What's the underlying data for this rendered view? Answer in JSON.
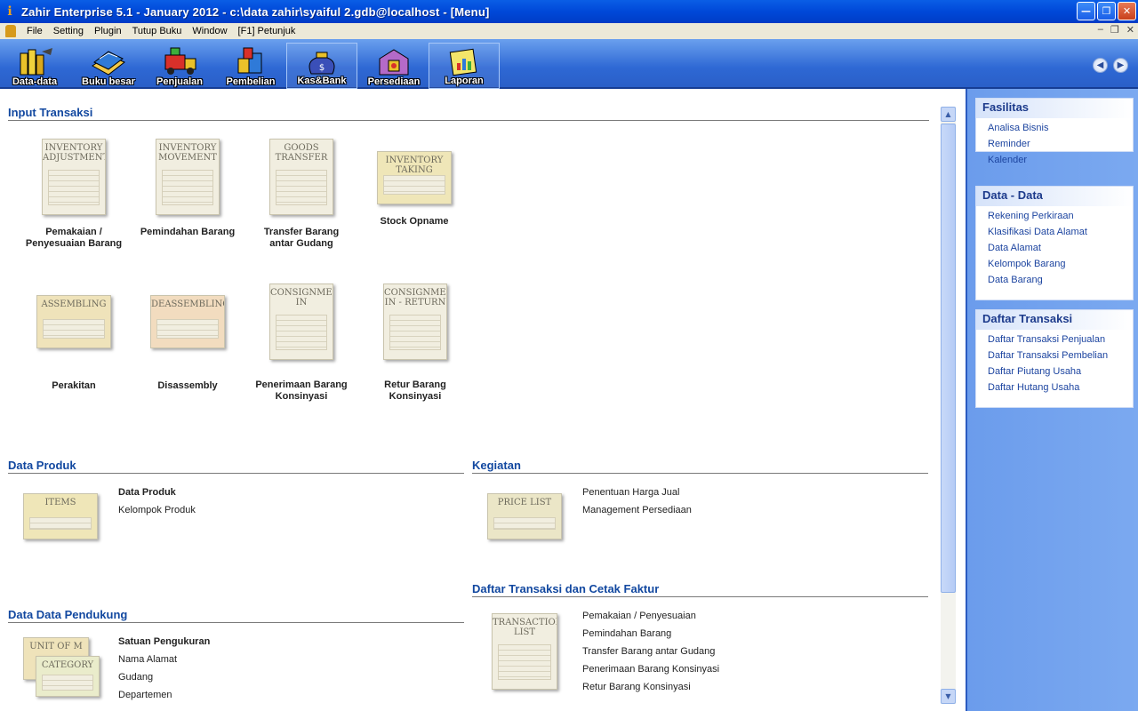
{
  "window": {
    "title": "Zahir Enterprise 5.1 - January 2012 - c:\\data zahir\\syaiful 2.gdb@localhost - [Menu]"
  },
  "menu": [
    "File",
    "Setting",
    "Plugin",
    "Tutup Buku",
    "Window",
    "[F1] Petunjuk"
  ],
  "toolbar": [
    {
      "label": "Data-data",
      "icon": "data-data-icon"
    },
    {
      "label": "Buku besar",
      "icon": "ledger-books-icon"
    },
    {
      "label": "Penjualan",
      "icon": "sales-truck-icon"
    },
    {
      "label": "Pembelian",
      "icon": "purchase-boxes-icon"
    },
    {
      "label": "Kas&Bank",
      "icon": "money-bag-icon",
      "selected": true
    },
    {
      "label": "Persediaan",
      "icon": "warehouse-icon"
    },
    {
      "label": "Laporan",
      "icon": "report-chart-icon",
      "selected": true
    }
  ],
  "sections": {
    "input_transaksi": "Input Transaksi",
    "data_produk": "Data Produk",
    "kegiatan": "Kegiatan",
    "daftar_transaksi": "Daftar Transaksi dan Cetak Faktur",
    "data_pendukung": "Data Data Pendukung"
  },
  "tiles": {
    "t1": {
      "doc": "Inventory Adjustment",
      "caption": "Pemakaian / Penyesuaian Barang"
    },
    "t2": {
      "doc": "Inventory Movement",
      "caption": "Pemindahan Barang"
    },
    "t3": {
      "doc": "Goods Transfer",
      "caption": "Transfer Barang antar Gudang"
    },
    "t4": {
      "doc": "Inventory Taking",
      "caption": "Stock Opname"
    },
    "t5": {
      "doc": "Assembling",
      "caption": "Perakitan"
    },
    "t6": {
      "doc": "Deassembling",
      "caption": "Disassembly"
    },
    "t7": {
      "doc": "Consignment In",
      "caption": "Penerimaan Barang Konsinyasi"
    },
    "t8": {
      "doc": "Consignment In - Return",
      "caption": "Retur Barang Konsinyasi"
    },
    "items": {
      "doc": "Items"
    },
    "price": {
      "doc": "Price List"
    },
    "trans": {
      "doc": "Transaction List"
    },
    "unit": {
      "doc": "Unit of M"
    },
    "cat": {
      "doc": "Category"
    }
  },
  "links": {
    "produk": [
      "Data Produk",
      "Kelompok Produk"
    ],
    "kegiatan": [
      "Penentuan Harga Jual",
      "Management Persediaan"
    ],
    "daftar": [
      "Pemakaian / Penyesuaian",
      "Pemindahan Barang",
      "Transfer Barang antar Gudang",
      "Penerimaan Barang Konsinyasi",
      "Retur Barang Konsinyasi"
    ],
    "pendukung": [
      "Satuan Pengukuran",
      "Nama Alamat",
      "Gudang",
      "Departemen"
    ]
  },
  "sidebar": {
    "fasilitas": {
      "title": "Fasilitas",
      "items": [
        "Analisa Bisnis",
        "Reminder",
        "Kalender"
      ]
    },
    "datadata": {
      "title": "Data - Data",
      "items": [
        "Rekening Perkiraan",
        "Klasifikasi Data Alamat",
        "Data Alamat",
        "Kelompok Barang",
        "Data Barang"
      ]
    },
    "daftar": {
      "title": "Daftar Transaksi",
      "items": [
        "Daftar Transaksi Penjualan",
        "Daftar Transaksi Pembelian",
        "Daftar Piutang Usaha",
        "Daftar Hutang Usaha"
      ]
    }
  }
}
